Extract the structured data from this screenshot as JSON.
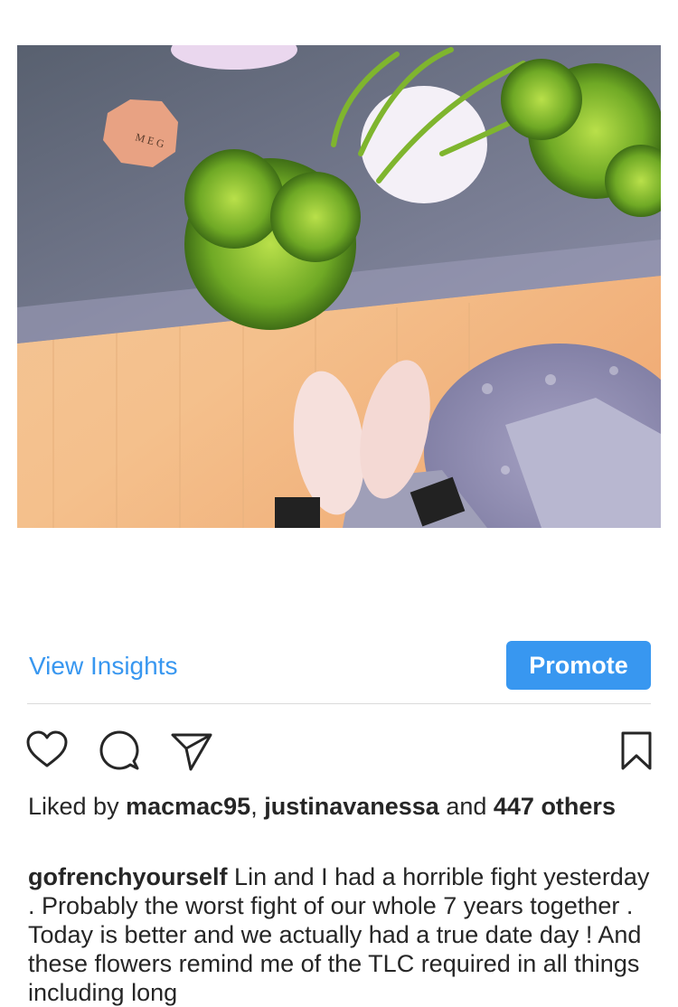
{
  "post": {
    "insights_label": "View Insights",
    "promote_label": "Promote",
    "likes": {
      "prefix": "Liked by ",
      "user1": "macmac95",
      "separator": ", ",
      "user2": "justinavanessa",
      "and_text": " and ",
      "others_count": "447 others"
    },
    "caption": {
      "username": "gofrenchyourself",
      "text": " Lin and I had a horrible fight yesterday . Probably the worst fight of our whole 7 years together . Today is better and we actually had a true date day ! And these flowers remind me of the TLC required in all things including long"
    }
  },
  "icons": {
    "like": "heart-icon",
    "comment": "comment-icon",
    "share": "paper-plane-icon",
    "save": "bookmark-icon"
  },
  "colors": {
    "accent": "#3897f0",
    "text": "#262626",
    "divider": "#dbdbdb"
  }
}
